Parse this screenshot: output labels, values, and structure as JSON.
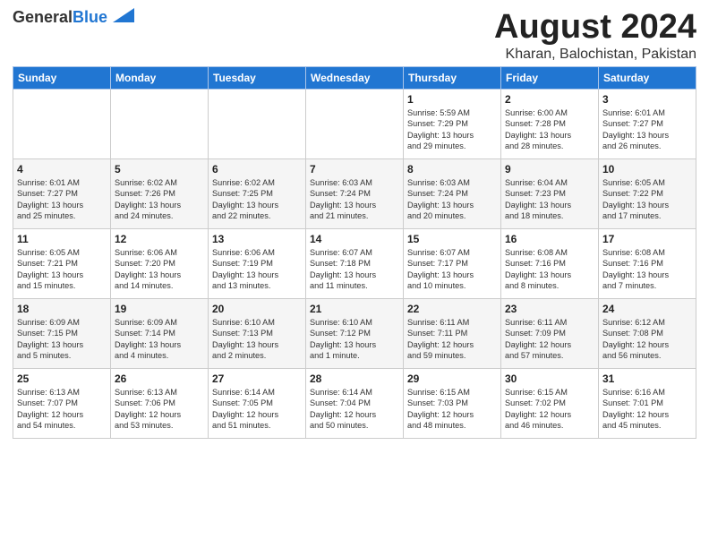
{
  "logo": {
    "part1": "General",
    "part2": "Blue"
  },
  "header": {
    "month_year": "August 2024",
    "location": "Kharan, Balochistan, Pakistan"
  },
  "days_of_week": [
    "Sunday",
    "Monday",
    "Tuesday",
    "Wednesday",
    "Thursday",
    "Friday",
    "Saturday"
  ],
  "weeks": [
    [
      {
        "day": "",
        "info": ""
      },
      {
        "day": "",
        "info": ""
      },
      {
        "day": "",
        "info": ""
      },
      {
        "day": "",
        "info": ""
      },
      {
        "day": "1",
        "info": "Sunrise: 5:59 AM\nSunset: 7:29 PM\nDaylight: 13 hours\nand 29 minutes."
      },
      {
        "day": "2",
        "info": "Sunrise: 6:00 AM\nSunset: 7:28 PM\nDaylight: 13 hours\nand 28 minutes."
      },
      {
        "day": "3",
        "info": "Sunrise: 6:01 AM\nSunset: 7:27 PM\nDaylight: 13 hours\nand 26 minutes."
      }
    ],
    [
      {
        "day": "4",
        "info": "Sunrise: 6:01 AM\nSunset: 7:27 PM\nDaylight: 13 hours\nand 25 minutes."
      },
      {
        "day": "5",
        "info": "Sunrise: 6:02 AM\nSunset: 7:26 PM\nDaylight: 13 hours\nand 24 minutes."
      },
      {
        "day": "6",
        "info": "Sunrise: 6:02 AM\nSunset: 7:25 PM\nDaylight: 13 hours\nand 22 minutes."
      },
      {
        "day": "7",
        "info": "Sunrise: 6:03 AM\nSunset: 7:24 PM\nDaylight: 13 hours\nand 21 minutes."
      },
      {
        "day": "8",
        "info": "Sunrise: 6:03 AM\nSunset: 7:24 PM\nDaylight: 13 hours\nand 20 minutes."
      },
      {
        "day": "9",
        "info": "Sunrise: 6:04 AM\nSunset: 7:23 PM\nDaylight: 13 hours\nand 18 minutes."
      },
      {
        "day": "10",
        "info": "Sunrise: 6:05 AM\nSunset: 7:22 PM\nDaylight: 13 hours\nand 17 minutes."
      }
    ],
    [
      {
        "day": "11",
        "info": "Sunrise: 6:05 AM\nSunset: 7:21 PM\nDaylight: 13 hours\nand 15 minutes."
      },
      {
        "day": "12",
        "info": "Sunrise: 6:06 AM\nSunset: 7:20 PM\nDaylight: 13 hours\nand 14 minutes."
      },
      {
        "day": "13",
        "info": "Sunrise: 6:06 AM\nSunset: 7:19 PM\nDaylight: 13 hours\nand 13 minutes."
      },
      {
        "day": "14",
        "info": "Sunrise: 6:07 AM\nSunset: 7:18 PM\nDaylight: 13 hours\nand 11 minutes."
      },
      {
        "day": "15",
        "info": "Sunrise: 6:07 AM\nSunset: 7:17 PM\nDaylight: 13 hours\nand 10 minutes."
      },
      {
        "day": "16",
        "info": "Sunrise: 6:08 AM\nSunset: 7:16 PM\nDaylight: 13 hours\nand 8 minutes."
      },
      {
        "day": "17",
        "info": "Sunrise: 6:08 AM\nSunset: 7:16 PM\nDaylight: 13 hours\nand 7 minutes."
      }
    ],
    [
      {
        "day": "18",
        "info": "Sunrise: 6:09 AM\nSunset: 7:15 PM\nDaylight: 13 hours\nand 5 minutes."
      },
      {
        "day": "19",
        "info": "Sunrise: 6:09 AM\nSunset: 7:14 PM\nDaylight: 13 hours\nand 4 minutes."
      },
      {
        "day": "20",
        "info": "Sunrise: 6:10 AM\nSunset: 7:13 PM\nDaylight: 13 hours\nand 2 minutes."
      },
      {
        "day": "21",
        "info": "Sunrise: 6:10 AM\nSunset: 7:12 PM\nDaylight: 13 hours\nand 1 minute."
      },
      {
        "day": "22",
        "info": "Sunrise: 6:11 AM\nSunset: 7:11 PM\nDaylight: 12 hours\nand 59 minutes."
      },
      {
        "day": "23",
        "info": "Sunrise: 6:11 AM\nSunset: 7:09 PM\nDaylight: 12 hours\nand 57 minutes."
      },
      {
        "day": "24",
        "info": "Sunrise: 6:12 AM\nSunset: 7:08 PM\nDaylight: 12 hours\nand 56 minutes."
      }
    ],
    [
      {
        "day": "25",
        "info": "Sunrise: 6:13 AM\nSunset: 7:07 PM\nDaylight: 12 hours\nand 54 minutes."
      },
      {
        "day": "26",
        "info": "Sunrise: 6:13 AM\nSunset: 7:06 PM\nDaylight: 12 hours\nand 53 minutes."
      },
      {
        "day": "27",
        "info": "Sunrise: 6:14 AM\nSunset: 7:05 PM\nDaylight: 12 hours\nand 51 minutes."
      },
      {
        "day": "28",
        "info": "Sunrise: 6:14 AM\nSunset: 7:04 PM\nDaylight: 12 hours\nand 50 minutes."
      },
      {
        "day": "29",
        "info": "Sunrise: 6:15 AM\nSunset: 7:03 PM\nDaylight: 12 hours\nand 48 minutes."
      },
      {
        "day": "30",
        "info": "Sunrise: 6:15 AM\nSunset: 7:02 PM\nDaylight: 12 hours\nand 46 minutes."
      },
      {
        "day": "31",
        "info": "Sunrise: 6:16 AM\nSunset: 7:01 PM\nDaylight: 12 hours\nand 45 minutes."
      }
    ]
  ]
}
